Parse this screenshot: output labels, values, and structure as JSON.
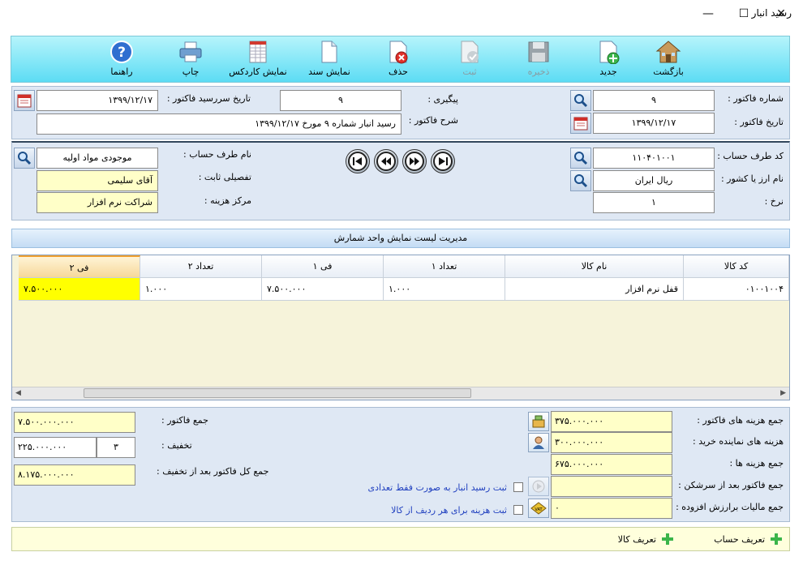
{
  "window": {
    "title": "رسید انبار",
    "minimize": "—",
    "maximize": "☐",
    "close": "✕"
  },
  "toolbar": {
    "back": "بازگشت",
    "new": "جدید",
    "save": "ذخیره",
    "register": "ثبت",
    "delete": "حذف",
    "show_doc": "نمایش سند",
    "show_cardex": "نمایش کاردکس",
    "print": "چاپ",
    "help": "راهنما"
  },
  "header": {
    "invoice_number_label": "شماره فاکتور :",
    "invoice_number": "۹",
    "invoice_date_label": "تاریخ فاکتور :",
    "invoice_date": "۱۳۹۹/۱۲/۱۷",
    "followup_label": "پیگیری :",
    "followup": "۹",
    "invoice_desc_label": "شرح فاکتور :",
    "invoice_desc": "رسید انبار شماره ۹ مورخ ۱۳۹۹/۱۲/۱۷",
    "due_date_label": "تاریخ سررسید فاکتور :",
    "due_date": "۱۳۹۹/۱۲/۱۷"
  },
  "account": {
    "account_code_label": "کد طرف حساب :",
    "account_code": "۱۱۰۴۰۱۰۰۱",
    "currency_label": "نام ارز یا کشور :",
    "currency": "ریال ایران",
    "rate_label": "نرخ :",
    "rate": "۱",
    "account_name_label": "نام طرف حساب :",
    "account_name": "موجودی مواد اولیه",
    "detail_label": "تفصیلی ثابت :",
    "detail": "آقای سلیمی",
    "cost_center_label": "مرکز هزینه :",
    "cost_center": "شراکت نرم افزار"
  },
  "list_title": "مدیریت لیست نمایش واحد شمارش",
  "grid": {
    "columns": [
      "کد کالا",
      "نام کالا",
      "تعداد ۱",
      "فی ۱",
      "تعداد ۲",
      "فی ۲"
    ],
    "rows": [
      [
        "۰۱۰۰۱۰۰۴",
        "قفل نرم افزار",
        "۱.۰۰۰",
        "۷.۵۰۰.۰۰۰",
        "۱.۰۰۰",
        "۷.۵۰۰.۰۰۰"
      ]
    ]
  },
  "totals": {
    "invoice_total_label": "جمع فاکتور :",
    "invoice_total": "۷.۵۰۰.۰۰۰.۰۰۰",
    "discount_label": "تخفیف :",
    "discount_value": "۲۲۵.۰۰۰.۰۰۰",
    "discount_percent": "۳",
    "grand_total_label": "جمع کل فاکتور بعد از تخفیف :",
    "grand_total": "۸.۱۷۵.۰۰۰.۰۰۰",
    "costs_total_label": "جمع هزینه های فاکتور :",
    "costs_total": "۳۷۵.۰۰۰.۰۰۰",
    "agent_cost_label": "هزینه های نماینده خرید :",
    "agent_cost": "۳۰۰.۰۰۰.۰۰۰",
    "cost_sum_label": "جمع هزینه ها :",
    "cost_sum": "۶۷۵.۰۰۰.۰۰۰",
    "after_overhead_label": "جمع فاکتور بعد از سرشکن :",
    "after_overhead": "",
    "vat_label": "جمع مالیات برارزش افزوده :",
    "vat": "۰",
    "chk_quantity_label": "ثبت رسید انبار به صورت فقط تعدادی",
    "chk_cost_label": "ثبت هزینه برای هر ردیف از کالا"
  },
  "bottom": {
    "define_account": "تعریف حساب",
    "define_item": "تعریف کالا"
  },
  "colors": {
    "toolbar_top": "#b6f4fb",
    "toolbar_bottom": "#5cdcf4",
    "highlight": "#ffff00",
    "link": "#1f3fbf"
  }
}
